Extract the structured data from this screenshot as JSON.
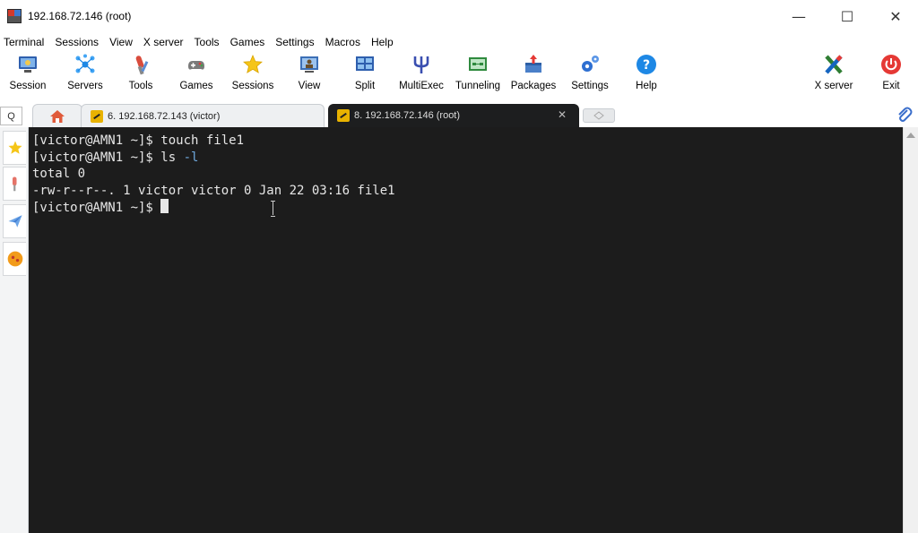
{
  "window": {
    "title": "192.168.72.146 (root)",
    "min_glyph": "—",
    "max_glyph": "☐",
    "close_glyph": "✕"
  },
  "menu": [
    "Terminal",
    "Sessions",
    "View",
    "X server",
    "Tools",
    "Games",
    "Settings",
    "Macros",
    "Help"
  ],
  "toolbar": [
    {
      "label": "Session",
      "icon": "session-icon"
    },
    {
      "label": "Servers",
      "icon": "servers-icon"
    },
    {
      "label": "Tools",
      "icon": "tools-icon"
    },
    {
      "label": "Games",
      "icon": "games-icon"
    },
    {
      "label": "Sessions",
      "icon": "sessions-star-icon"
    },
    {
      "label": "View",
      "icon": "view-icon"
    },
    {
      "label": "Split",
      "icon": "split-icon"
    },
    {
      "label": "MultiExec",
      "icon": "multiexec-icon"
    },
    {
      "label": "Tunneling",
      "icon": "tunneling-icon"
    },
    {
      "label": "Packages",
      "icon": "packages-icon"
    },
    {
      "label": "Settings",
      "icon": "settings-icon"
    },
    {
      "label": "Help",
      "icon": "help-icon"
    },
    {
      "label": "X server",
      "icon": "xserver-icon"
    },
    {
      "label": "Exit",
      "icon": "exit-icon"
    }
  ],
  "tabs": {
    "search_glyph": "Q",
    "tab1_label": "6. 192.168.72.143 (victor)",
    "tab2_label": "8. 192.168.72.146 (root)",
    "close_glyph": "✕"
  },
  "terminal": {
    "lines": [
      {
        "prompt": "[victor@AMN1 ~]$ ",
        "cmd": "touch file1",
        "flag": ""
      },
      {
        "prompt": "[victor@AMN1 ~]$ ",
        "cmd": "ls ",
        "flag": "-l"
      },
      {
        "prompt": "",
        "cmd": "total 0",
        "flag": ""
      },
      {
        "prompt": "",
        "cmd": "-rw-r--r--. 1 victor victor 0 Jan 22 03:16 file1",
        "flag": ""
      },
      {
        "prompt": "[victor@AMN1 ~]$ ",
        "cmd": "",
        "flag": ""
      }
    ]
  },
  "colors": {
    "terminal_bg": "#1c1c1c",
    "terminal_fg": "#e6e6e6",
    "flag": "#6fa8dc"
  }
}
